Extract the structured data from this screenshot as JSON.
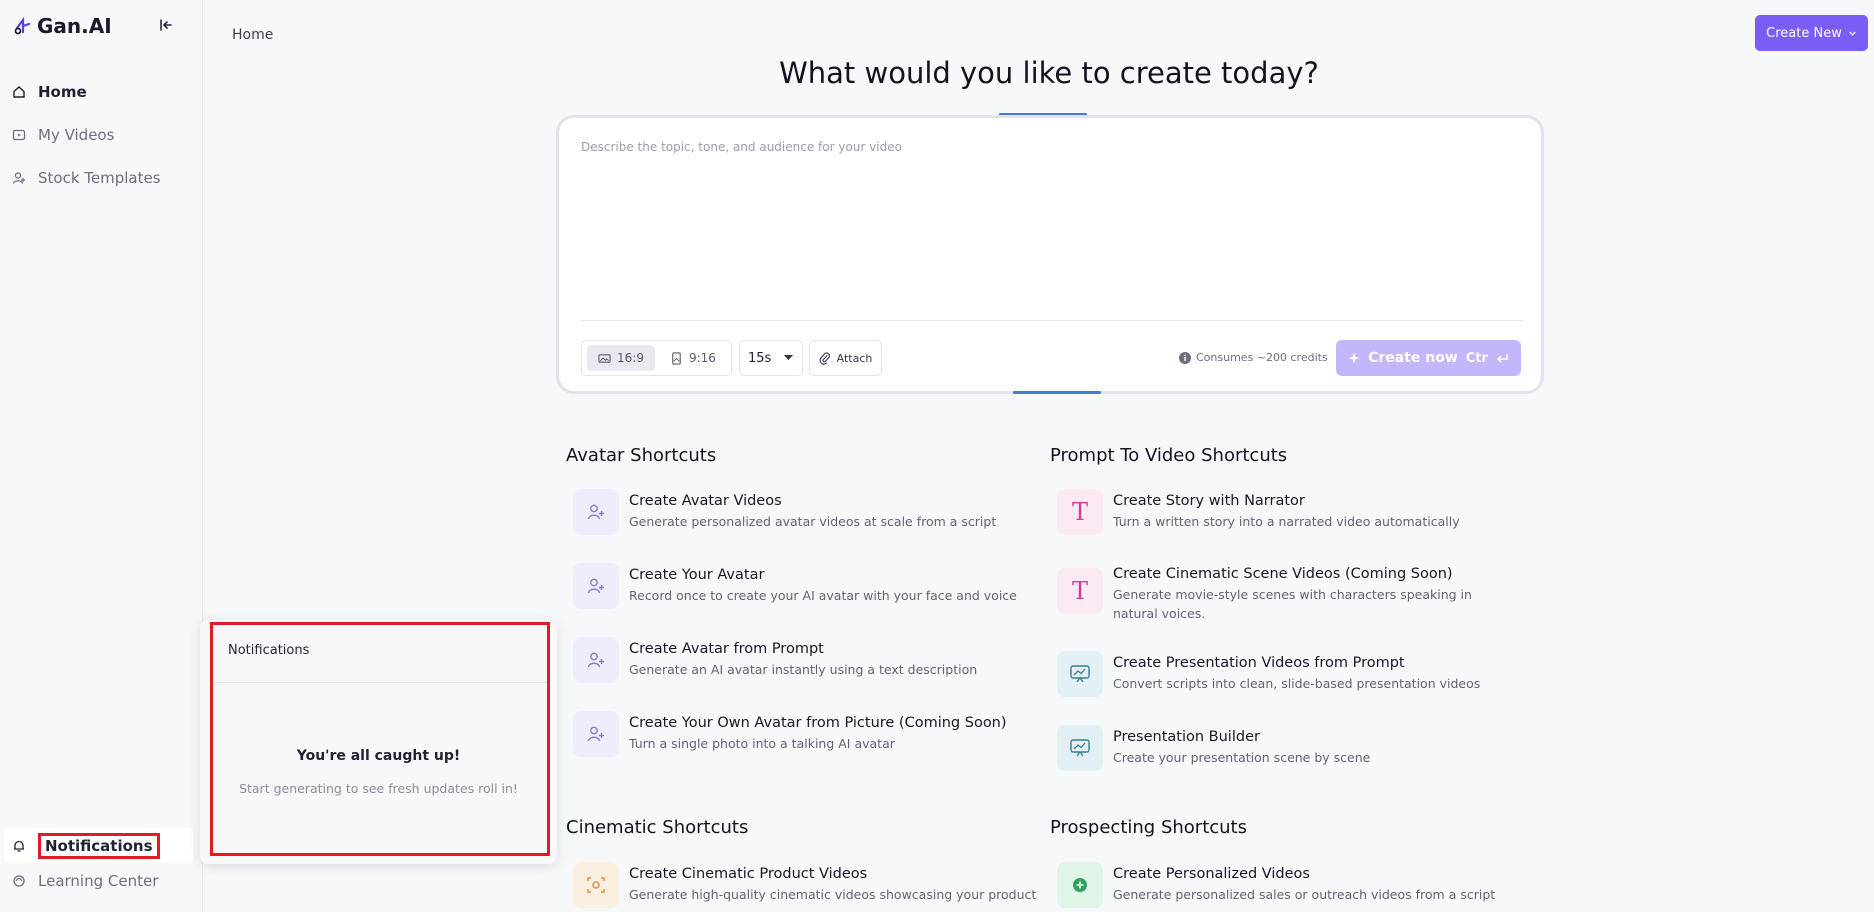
{
  "app": {
    "name": "Gan.AI"
  },
  "sidebar": {
    "items": [
      {
        "label": "Home",
        "icon": "home-icon",
        "active": true
      },
      {
        "label": "My Videos",
        "icon": "video-folder-icon"
      },
      {
        "label": "Stock Templates",
        "icon": "user-template-icon"
      }
    ],
    "bottom": [
      {
        "label": "Notifications",
        "icon": "bell-icon"
      },
      {
        "label": "Learning Center",
        "icon": "learning-icon"
      }
    ]
  },
  "header": {
    "breadcrumb": "Home",
    "create_new": "Create New"
  },
  "main": {
    "headline": "What would you like to create today?",
    "prompt": {
      "placeholder": "Describe the topic, tone, and audience for your video",
      "ratio_landscape": "16:9",
      "ratio_portrait": "9:16",
      "duration": "15s",
      "attach": "Attach",
      "credits": "Consumes ~200 credits",
      "create_now": "Create now",
      "shortcut": "Ctr"
    },
    "sections": {
      "avatar": "Avatar Shortcuts",
      "prompt_to_video": "Prompt To Video Shortcuts",
      "cinematic": "Cinematic Shortcuts",
      "prospecting": "Prospecting Shortcuts"
    },
    "avatar_shortcuts": [
      {
        "title": "Create Avatar Videos",
        "desc": "Generate personalized avatar videos at scale from a script"
      },
      {
        "title": "Create Your Avatar",
        "desc": "Record once to create your AI avatar with your face and voice"
      },
      {
        "title": "Create Avatar from Prompt",
        "desc": "Generate an AI avatar instantly using a text description"
      },
      {
        "title": "Create Your Own Avatar from Picture (Coming Soon)",
        "desc": "Turn a single photo into a talking AI avatar"
      }
    ],
    "prompt_shortcuts": [
      {
        "title": "Create Story with Narrator",
        "desc": "Turn a written story into a narrated video automatically"
      },
      {
        "title": "Create Cinematic Scene Videos (Coming Soon)",
        "desc": "Generate movie-style scenes with characters speaking in natural voices."
      },
      {
        "title": "Create Presentation Videos from Prompt",
        "desc": "Convert scripts into clean, slide-based presentation videos"
      },
      {
        "title": "Presentation Builder",
        "desc": "Create your presentation scene by scene"
      }
    ],
    "cinematic_shortcuts": [
      {
        "title": "Create Cinematic Product Videos",
        "desc": "Generate high-quality cinematic videos showcasing your product"
      }
    ],
    "prospecting_shortcuts": [
      {
        "title": "Create Personalized Videos",
        "desc": "Generate personalized sales or outreach videos from a script"
      }
    ]
  },
  "notifications": {
    "title": "Notifications",
    "empty_title": "You're all caught up!",
    "empty_subtitle": "Start generating to see fresh updates roll in!"
  },
  "colors": {
    "accent": "#7b5cf5",
    "highlight": "#e01b24",
    "create_now_disabled": "#c3b6fb"
  }
}
